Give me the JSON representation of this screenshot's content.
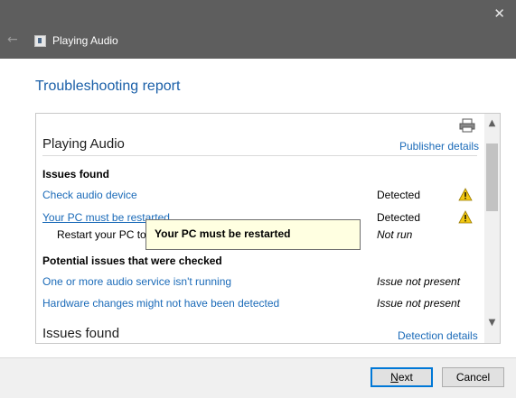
{
  "window": {
    "title": "Playing Audio",
    "close_glyph": "✕",
    "back_glyph": "←"
  },
  "heading": "Troubleshooting report",
  "report": {
    "section1_title": "Playing Audio",
    "publisher_link": "Publisher details",
    "issues_found_label": "Issues found",
    "issues": [
      {
        "label": "Check audio device",
        "status": "Detected",
        "icon": "warning-icon"
      },
      {
        "label": "Your PC must be restarted",
        "status": "Detected",
        "icon": "warning-icon"
      }
    ],
    "subaction": {
      "label": "Restart your PC to",
      "status": "Not run"
    },
    "potential_label": "Potential issues that were checked",
    "potential": [
      {
        "label": "One or more audio service isn't running",
        "status": "Issue not present"
      },
      {
        "label": "Hardware changes might not have been detected",
        "status": "Issue not present"
      }
    ],
    "section2_title": "Issues found",
    "detection_link": "Detection details"
  },
  "tooltip": "Your PC must be restarted",
  "buttons": {
    "next_first": "N",
    "next_rest": "ext",
    "cancel": "Cancel"
  },
  "colors": {
    "titlebar": "#5e5e5e",
    "link": "#1a6ab8",
    "heading": "#1a5fa8",
    "warning": "#f2c811",
    "tooltip_bg": "#ffffe1"
  }
}
